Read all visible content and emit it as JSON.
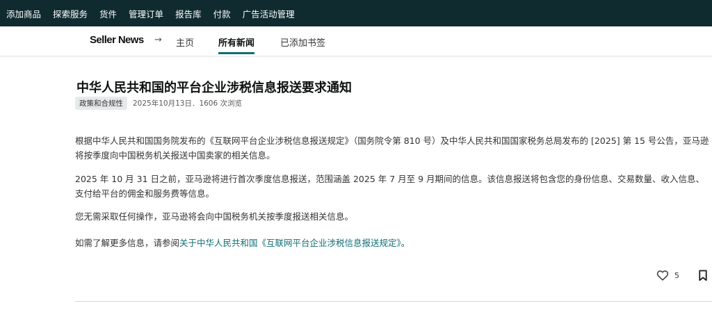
{
  "topnav": {
    "items": [
      "添加商品",
      "探索服务",
      "货件",
      "管理订单",
      "报告库",
      "付款",
      "广告活动管理"
    ]
  },
  "subnav": {
    "brand": "Seller News",
    "arrow": "→",
    "tabs": [
      "主页",
      "所有新闻",
      "已添加书签"
    ],
    "active_tab": "所有新闻"
  },
  "article": {
    "title": "中华人民共和国的平台企业涉税信息报送要求通知",
    "category": "政策和合规性",
    "meta": "2025年10月13日．1606 次浏览",
    "paragraphs": {
      "p1": "根据中华人民共和国国务院发布的《互联网平台企业涉税信息报送规定》（国务院令第 810 号）及中华人民共和国国家税务总局发布的 [2025] 第 15 号公告，亚马逊将按季度向中国税务机关报送中国卖家的相关信息。",
      "p2": "2025 年 10 月 31 日之前，亚马逊将进行首次季度信息报送，范围涵盖 2025 年 7 月至 9 月期间的信息。该信息报送将包含您的身份信息、交易数量、收入信息、支付给平台的佣金和服务费等信息。",
      "p3": "您无需采取任何操作，亚马逊将会向中国税务机关按季度报送相关信息。",
      "p4_prefix": "如需了解更多信息，请参阅",
      "p4_link": "关于中华人民共和国《互联网平台企业涉税信息报送规定》",
      "p4_suffix": "。"
    },
    "like_count": "5"
  },
  "colors": {
    "topnav_bg": "#0f2b30",
    "accent": "#0f6e74"
  },
  "icons": {
    "like": "heart-icon",
    "bookmark": "bookmark-icon",
    "arrow": "arrow-right-icon"
  }
}
